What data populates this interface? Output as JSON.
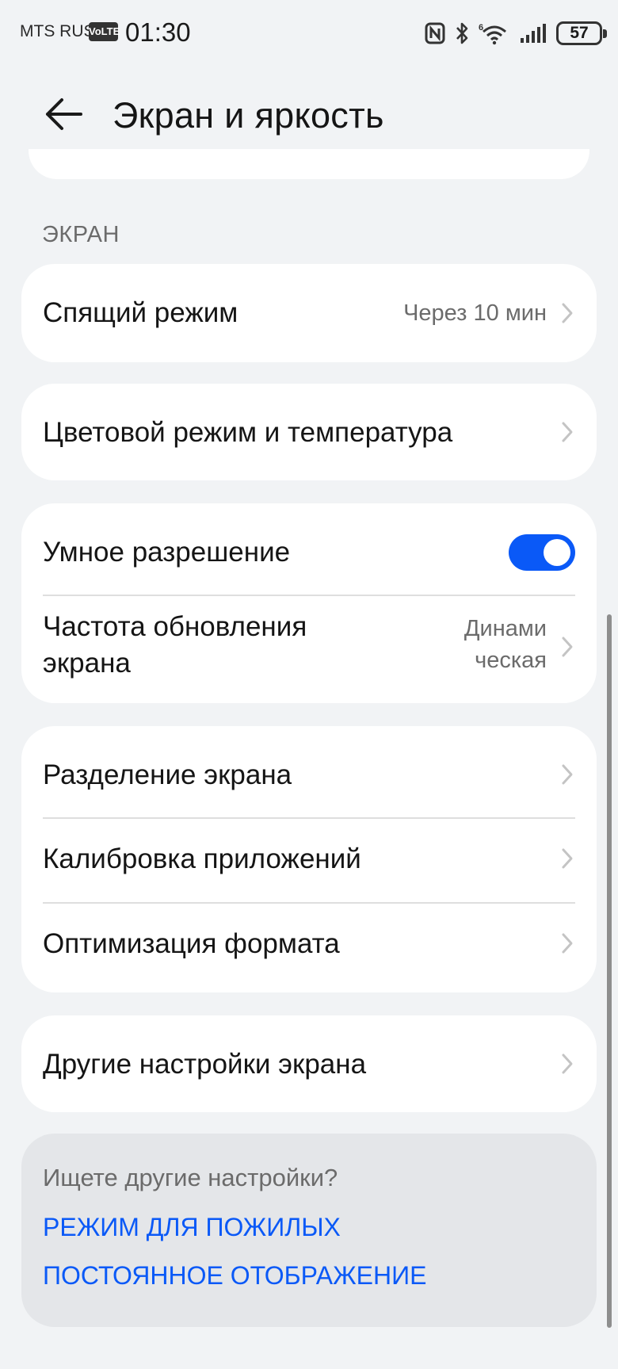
{
  "status_bar": {
    "carrier": "MTS RUS",
    "volte": "VoLTE",
    "time": "01:30",
    "battery_level": "57",
    "icons": [
      "nfc-icon",
      "bluetooth-icon",
      "wifi-6-icon",
      "signal-icon",
      "battery-icon"
    ]
  },
  "header": {
    "title": "Экран и яркость",
    "back_icon": "arrow-left-icon"
  },
  "section": {
    "label": "ЭКРАН"
  },
  "sleep": {
    "label": "Спящий режим",
    "value": "Через 10 мин"
  },
  "color_mode": {
    "label": "Цветовой режим и температура"
  },
  "smart_resolution": {
    "label": "Умное разрешение",
    "enabled": true
  },
  "refresh_rate": {
    "label_line1": "Частота обновления",
    "label_line2": "экрана",
    "value_line1": "Динами",
    "value_line2": "ческая"
  },
  "split_screen": {
    "label": "Разделение экрана"
  },
  "app_calibration": {
    "label": "Калибровка приложений"
  },
  "format_optimization": {
    "label": "Оптимизация формата"
  },
  "other_settings": {
    "label": "Другие настройки экрана"
  },
  "suggestions": {
    "question": "Ищете другие настройки?",
    "links": [
      "РЕЖИМ ДЛЯ ПОЖИЛЫХ",
      "ПОСТОЯННОЕ ОТОБРАЖЕНИЕ"
    ]
  },
  "colors": {
    "accent": "#0a59f7",
    "background": "#f1f3f5",
    "card": "#ffffff",
    "secondary_text": "#6b6b6b"
  }
}
